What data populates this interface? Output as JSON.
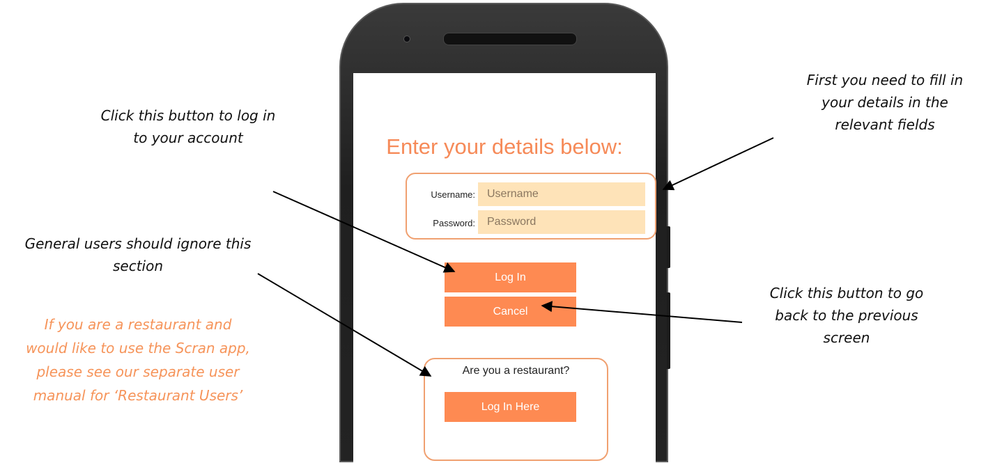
{
  "screen": {
    "heading": "Enter your details below:",
    "username_label": "Username:",
    "username_placeholder": "Username",
    "password_label": "Password:",
    "password_placeholder": "Password",
    "login_label": "Log In",
    "cancel_label": "Cancel",
    "restaurant_prompt": "Are you a restaurant?",
    "restaurant_login_label": "Log In Here"
  },
  "annotations": {
    "login_note": [
      "Click this button to log in",
      "to your account"
    ],
    "fields_note": [
      "First you need to fill in",
      "your details in the",
      "relevant fields"
    ],
    "general_note": [
      "General users should ignore this",
      "section"
    ],
    "restaurant_note": [
      "If you are a restaurant and",
      "would like to use the Scran app,",
      "please see our separate user",
      "manual for ‘Restaurant Users’"
    ],
    "cancel_note": [
      "Click this button to go",
      "back to the previous",
      "screen"
    ]
  },
  "colors": {
    "accent": "#fe8a52",
    "heading": "#f68a58",
    "input_bg": "#fee3b8",
    "box_border": "#f0a070",
    "restaurant_note": "#f6945a"
  }
}
